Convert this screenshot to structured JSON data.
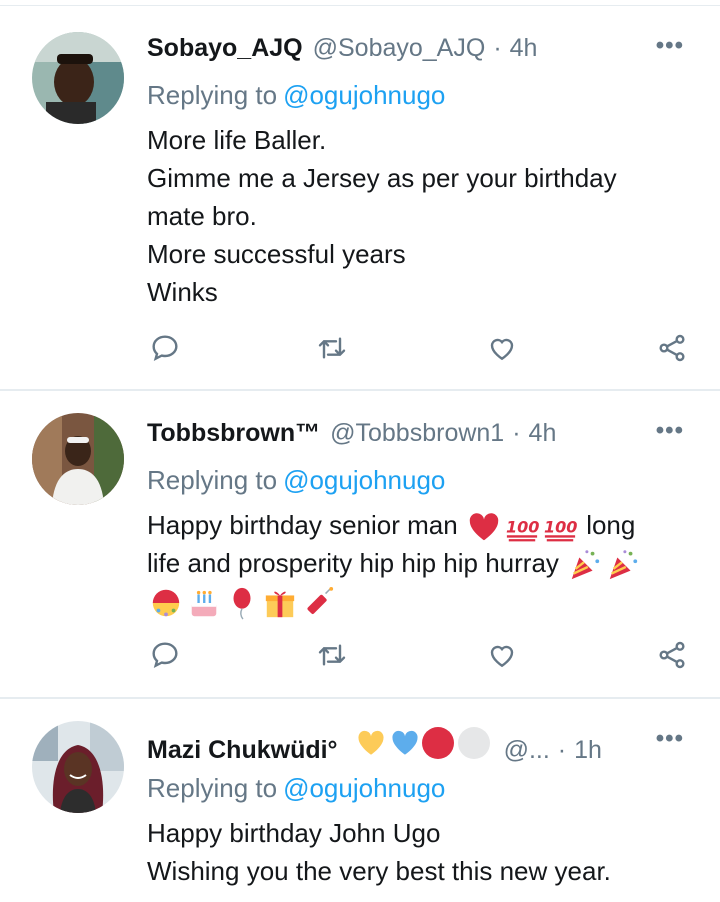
{
  "tweets": [
    {
      "name": "Sobayo_AJQ",
      "handle": "@Sobayo_AJQ",
      "separator": "·",
      "time": "4h",
      "replying_prefix": "Replying to",
      "replying_mention": "@ogujohnugo",
      "lines": [
        "More life Baller.",
        "Gimme me a Jersey as per your birthday",
        "mate bro.",
        "More successful years",
        "Winks"
      ],
      "avatar": "person-selfie",
      "more_icon": "more-horizontal-icon"
    },
    {
      "name": "Tobbsbrown™",
      "handle": "@Tobbsbrown1",
      "separator": "·",
      "time": "4h",
      "replying_prefix": "Replying to",
      "replying_mention": "@ogujohnugo",
      "line1_text": "Happy birthday senior man",
      "line1_tail": "long",
      "line2_text": "life and prosperity hip hip hip hurray",
      "emojis_line1": [
        "red-heart-emoji",
        "hundred-points-emoji",
        "hundred-points-emoji"
      ],
      "emojis_line2": [
        "party-popper-emoji",
        "party-popper-emoji"
      ],
      "emojis_line3": [
        "confetti-ball-emoji",
        "birthday-cake-emoji",
        "balloon-emoji",
        "wrapped-gift-emoji",
        "firecracker-emoji"
      ],
      "avatar": "person-seated-outdoors"
    },
    {
      "name": "Mazi Chukwüdi°",
      "handle": "@...",
      "separator": "·",
      "time": "1h",
      "replying_prefix": "Replying to",
      "replying_mention": "@ogujohnugo",
      "lines": [
        "Happy birthday John Ugo",
        "Wishing you the very best this new year."
      ],
      "name_emojis": [
        "yellow-heart",
        "blue-heart",
        "red-circle",
        "white-circle"
      ],
      "avatar": "woman-smiling"
    }
  ],
  "actions": [
    "reply-icon",
    "retweet-icon",
    "like-icon",
    "share-icon"
  ],
  "colors": {
    "text": "#14171a",
    "secondary": "#657786",
    "link": "#1da1f2",
    "divider": "#e6ecf0",
    "icon": "#657786"
  }
}
